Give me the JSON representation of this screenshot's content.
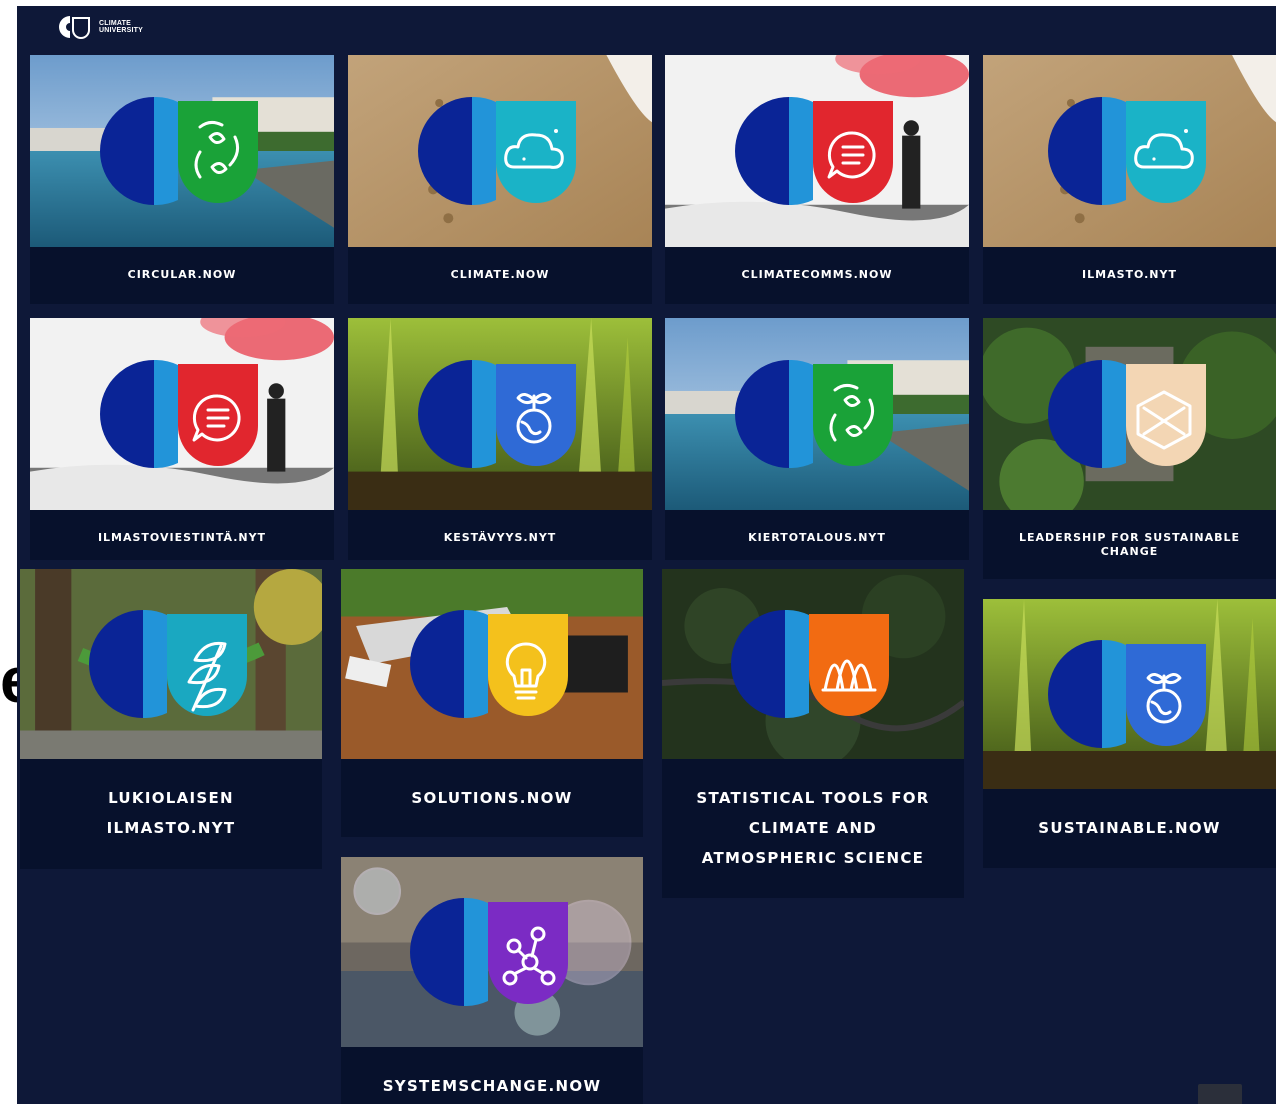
{
  "brand": {
    "name_line1": "CLIMATE",
    "name_line2": "UNIVERSITY"
  },
  "edge_glyph": "e",
  "courses": [
    {
      "title": "CIRCULAR.NOW",
      "scene": "city-harbor",
      "icon": "recycle-leaves-icon",
      "shield_color": "#1aa238"
    },
    {
      "title": "CLIMATE.NOW",
      "scene": "sandy-beach",
      "icon": "cloud-icon",
      "shield_color": "#1ab3c7"
    },
    {
      "title": "CLIMATECOMMS.NOW",
      "scene": "flare-on-snow",
      "icon": "speech-bubble-icon",
      "shield_color": "#e1262e"
    },
    {
      "title": "ILMASTO.NYT",
      "scene": "sandy-beach",
      "icon": "cloud-icon",
      "shield_color": "#1ab3c7"
    },
    {
      "title": "ILMASTOVIESTINTÄ.NYT",
      "scene": "flare-on-snow",
      "icon": "speech-bubble-icon",
      "shield_color": "#e1262e"
    },
    {
      "title": "KESTÄVYYS.NYT",
      "scene": "green-sprouts",
      "icon": "globe-sprout-icon",
      "shield_color": "#2f6ad6"
    },
    {
      "title": "KIERTOTALOUS.NYT",
      "scene": "city-harbor",
      "icon": "recycle-leaves-icon",
      "shield_color": "#1aa238"
    },
    {
      "title": "LEADERSHIP FOR SUSTAINABLE CHANGE",
      "scene": "forest-stairs",
      "icon": "box-cross-icon",
      "shield_color": "#f3d6b4"
    },
    {
      "title": "LUKIOLAISEN ILMASTO.NYT",
      "scene": "forest-hammock",
      "icon": "leaves-icon",
      "shield_color": "#1aa8c1"
    },
    {
      "title": "SOLUTIONS.NOW",
      "scene": "laptop-desk",
      "icon": "lightbulb-icon",
      "shield_color": "#f4c11c"
    },
    {
      "title": "STATISTICAL TOOLS FOR CLIMATE AND ATMOSPHERIC SCIENCE",
      "scene": "forest-aerial",
      "icon": "distribution-curves-icon",
      "shield_color": "#f26b12"
    },
    {
      "title": "SUSTAINABLE.NOW",
      "scene": "green-sprouts",
      "icon": "globe-sprout-icon",
      "shield_color": "#2f6ad6"
    },
    {
      "title": "SYSTEMSCHANGE.NOW",
      "scene": "bubbles-street",
      "icon": "network-nodes-icon",
      "shield_color": "#7b2bc4"
    }
  ],
  "colors": {
    "page_bg": "#0e1838",
    "card_bg": "#07112c",
    "logo_dark_blue": "#0a2496",
    "logo_light_blue": "#2294d9"
  }
}
